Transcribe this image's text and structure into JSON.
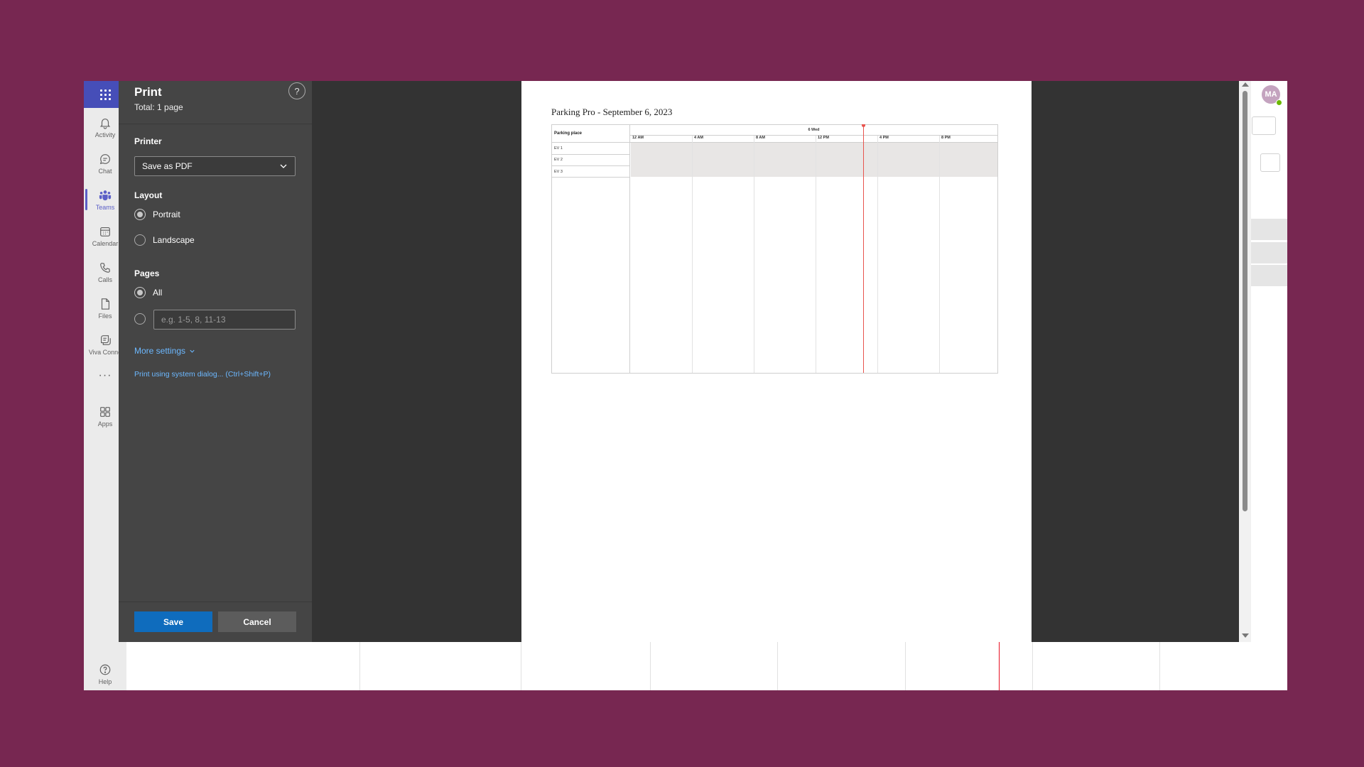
{
  "rail": {
    "items": [
      {
        "label": "Activity",
        "icon": "bell-icon"
      },
      {
        "label": "Chat",
        "icon": "chat-icon"
      },
      {
        "label": "Teams",
        "icon": "teams-icon"
      },
      {
        "label": "Calendar",
        "icon": "calendar-icon"
      },
      {
        "label": "Calls",
        "icon": "phone-icon"
      },
      {
        "label": "Files",
        "icon": "file-icon"
      },
      {
        "label": "Viva Conne",
        "icon": "viva-icon"
      },
      {
        "label": "Apps",
        "icon": "apps-icon"
      }
    ],
    "more": "···",
    "help": "Help"
  },
  "user": {
    "initials": "MA",
    "status_color": "#6bb700"
  },
  "print": {
    "title": "Print",
    "total": "Total: 1 page",
    "help": "?",
    "printer_label": "Printer",
    "printer_value": "Save as PDF",
    "layout_label": "Layout",
    "layout_portrait": "Portrait",
    "layout_landscape": "Landscape",
    "layout_selected": "Portrait",
    "pages_label": "Pages",
    "pages_all": "All",
    "pages_selected": "All",
    "pages_placeholder": "e.g. 1-5, 8, 11-13",
    "more_settings": "More settings",
    "system_dialog": "Print using system dialog... (Ctrl+Shift+P)",
    "save": "Save",
    "cancel": "Cancel"
  },
  "preview": {
    "title": "Parking Pro - September 6, 2023",
    "column_header": "Parking place",
    "date_header": "6 Wed",
    "times": [
      "12 AM",
      "4 AM",
      "8 AM",
      "12 PM",
      "4 PM",
      "8 PM"
    ],
    "rows": [
      "EV 1",
      "EV 2",
      "EV 3"
    ]
  },
  "colors": {
    "brand": "#464eb8",
    "accent_button": "#0f6cbd",
    "link": "#6cb8ff",
    "now_line": "#e8544e",
    "background": "#772751"
  }
}
